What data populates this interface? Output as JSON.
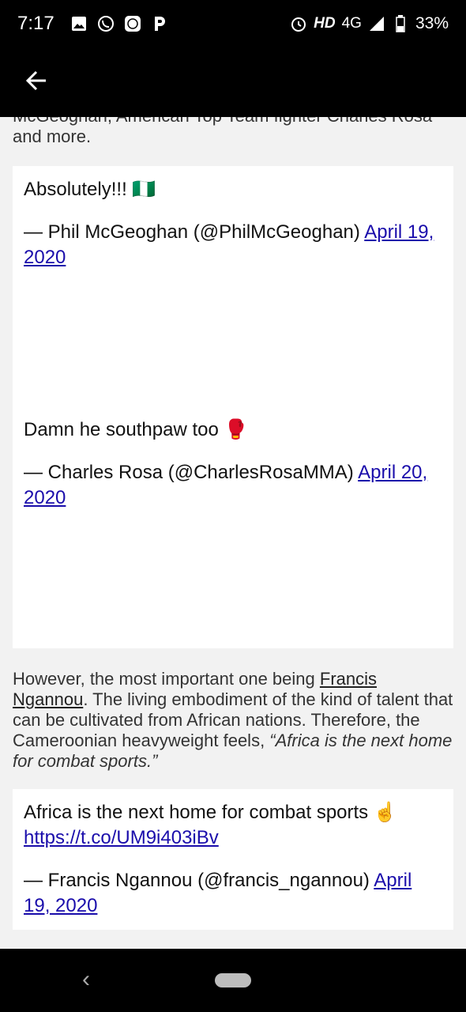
{
  "status_bar": {
    "time": "7:17",
    "hd": "HD",
    "network": "4G",
    "battery": "33%"
  },
  "article": {
    "intro_partial": "McGeoghan, American Top Team fighter Charles Rosa and more.",
    "tweets": [
      {
        "text": "Absolutely!!! 🇳🇬",
        "byline": "— Phil McGeoghan (@PhilMcGeoghan)",
        "date": "April 19, 2020"
      },
      {
        "text": "Damn he southpaw too 🥊",
        "byline": "— Charles Rosa (@CharlesRosaMMA)",
        "date": "April 20, 2020"
      },
      {
        "text": "Africa is the next home for combat sports ☝️",
        "link": "https://t.co/UM9i403iBv",
        "byline": "— Francis Ngannou (@francis_ngannou)",
        "date": "April 19, 2020"
      }
    ],
    "paragraph": {
      "before_link": "However, the most important one being ",
      "link": "Francis Ngannou",
      "after_link": ". The living embodiment of the kind of talent that can be cultivated from African nations. Therefore, the Cameroonian heavyweight feels, ",
      "quote": "“Africa is the next home for combat sports.”"
    }
  },
  "colors": {
    "bar_bg": "#000000",
    "page_bg": "#f2f2f2",
    "link": "#1a0dab"
  }
}
